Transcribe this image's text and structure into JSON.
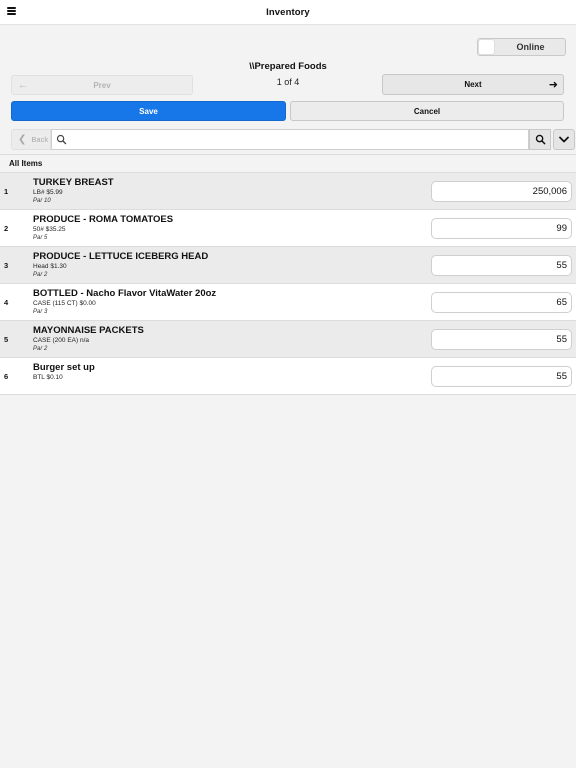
{
  "header": {
    "title": "Inventory",
    "menu_icon": "hamburger-menu-icon"
  },
  "status": {
    "online_label": "Online"
  },
  "category": {
    "title": "\\\\Prepared Foods"
  },
  "pagination": {
    "label": "1 of 4",
    "prev_label": "Prev",
    "next_label": "Next"
  },
  "actions": {
    "save_label": "Save",
    "cancel_label": "Cancel"
  },
  "search": {
    "back_label": "Back",
    "placeholder": "",
    "value": ""
  },
  "list": {
    "section_label": "All Items",
    "items": [
      {
        "num": "1",
        "name": "TURKEY BREAST",
        "detail": "LB# $5.99",
        "par": "Par 10",
        "qty": "250,006"
      },
      {
        "num": "2",
        "name": "PRODUCE - ROMA TOMATOES",
        "detail": "50# $35.25",
        "par": "Par 5",
        "qty": "99"
      },
      {
        "num": "3",
        "name": "PRODUCE - LETTUCE ICEBERG HEAD",
        "detail": "Head $1.30",
        "par": "Par 2",
        "qty": "55"
      },
      {
        "num": "4",
        "name": "BOTTLED - Nacho Flavor VitaWater 20oz",
        "detail": "CASE (115 CT) $0.00",
        "par": "Par 3",
        "qty": "65"
      },
      {
        "num": "5",
        "name": "MAYONNAISE PACKETS",
        "detail": "CASE (200 EA) n/a",
        "par": "Par 2",
        "qty": "55"
      },
      {
        "num": "6",
        "name": "Burger set up",
        "detail": "BTL $0.10",
        "par": "",
        "qty": "55"
      }
    ]
  },
  "colors": {
    "primary": "#1877e8",
    "background": "#f3f3f3",
    "row_alt": "#ebebeb"
  }
}
